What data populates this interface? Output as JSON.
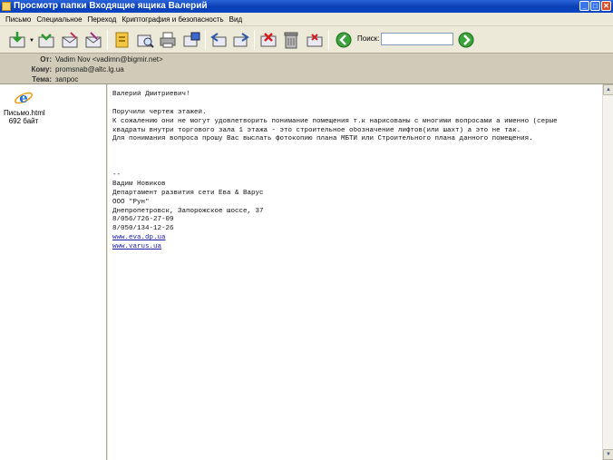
{
  "window": {
    "title": "Просмотр папки Входящие ящика Валерий",
    "buttons": {
      "minimize": "_",
      "maximize": "□",
      "close": "✕"
    }
  },
  "menu": [
    {
      "label": "Письмо"
    },
    {
      "label": "Специальное"
    },
    {
      "label": "Переход"
    },
    {
      "label": "Криптография и безопасность"
    },
    {
      "label": "Вид"
    }
  ],
  "toolbar": {
    "icons": [
      "get-mail-icon",
      "send-receive-icon",
      "new-mail-icon",
      "compose-icon",
      "address-book-icon",
      "find-icon",
      "print-icon",
      "mail-folder-icon",
      "reply-icon",
      "forward-icon",
      "delete-marked-icon",
      "trash-icon",
      "undelete-icon",
      "back-arrow-icon",
      "forward-arrow-icon"
    ],
    "search_label": "Поиск:",
    "search_value": ""
  },
  "message": {
    "from_label": "От:",
    "from": "Vadim Nov <vadimn@bigmir.net>",
    "to_label": "Кому:",
    "to": "promsnab@altc.lg.ua",
    "subject_label": "Тема:",
    "subject": "запрос"
  },
  "attachment": {
    "name": "Письмо.html",
    "size": "692 байт",
    "icon": "ie-document-icon"
  },
  "body": {
    "lines": [
      "Валерий Дмитриевич!",
      "",
      "Поручили чертеж этажей.",
      "К сожалению они не могут удовлетворить понимание помещения т.к нарисованы с многими вопросами а именно (серые",
      "квадраты внутри торгового зала 1 этажа - это строительное обозначение лифтов(или шахт) а это не так.",
      "Для понимания вопроса прошу Вас выслать фотокопию плана МБТИ или Строительного плана  данного помещения.",
      "",
      "",
      "",
      "--",
      "Вадим Новиков",
      "Департамент развития сети Ева & Варус",
      "ООО \"Рун\"",
      "Днепропетровск, Запорожское шоссе, 37",
      "8/056/726-27-09",
      "8/050/134-12-26"
    ],
    "links": [
      "www.eva.dp.ua",
      "www.varus.ua"
    ]
  },
  "colors": {
    "titlebar": "#0a3fb6",
    "header_bg": "#cfcbb8",
    "link": "#1a1aa6"
  }
}
